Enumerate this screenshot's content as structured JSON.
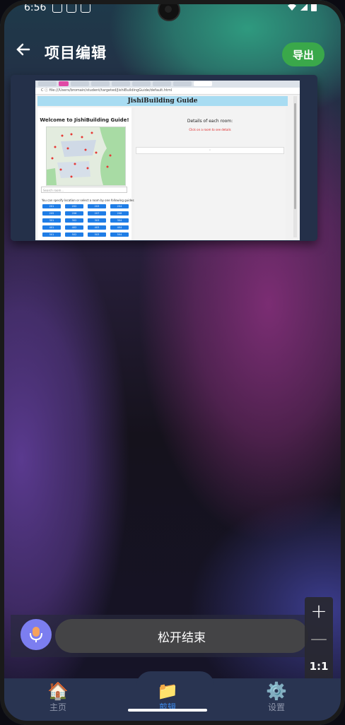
{
  "status_bar": {
    "time": "6:56"
  },
  "header": {
    "title": "项目编辑",
    "export_label": "导出"
  },
  "preview": {
    "page_header": "JishiBuilding Guide",
    "url": "C  ⓘ  file:///Users/bromain/student/targeted/JishiBuildingGuide/default.html",
    "welcome": "Welcome to JishiBuilding Guide!",
    "search_placeholder": "Search room...",
    "hint": "You can specify location or select a room by one following guides:",
    "details": "Details of each room:",
    "red_text": "Click on a room to see details",
    "bar_text": "◦",
    "rooms": [
      "201",
      "202",
      "203",
      "204",
      "205",
      "206",
      "207",
      "208",
      "301",
      "302",
      "303",
      "304",
      "401",
      "402",
      "403",
      "404",
      "501",
      "502",
      "503",
      "504"
    ]
  },
  "voice": {
    "hold_label": "松开结束"
  },
  "zoom": {
    "plus": "+",
    "minus": "—",
    "one_to_one": "1:1"
  },
  "nav": {
    "items": [
      {
        "label": "主页",
        "icon": "🏠",
        "active": false
      },
      {
        "label": "剪辑",
        "icon": "📁",
        "active": true
      },
      {
        "label": "设置",
        "icon": "⚙️",
        "active": false
      }
    ]
  },
  "colors": {
    "export_bg": "#3aa84a",
    "mic_bg": "#7c7ef0",
    "nav_active": "#3d8cf0"
  }
}
